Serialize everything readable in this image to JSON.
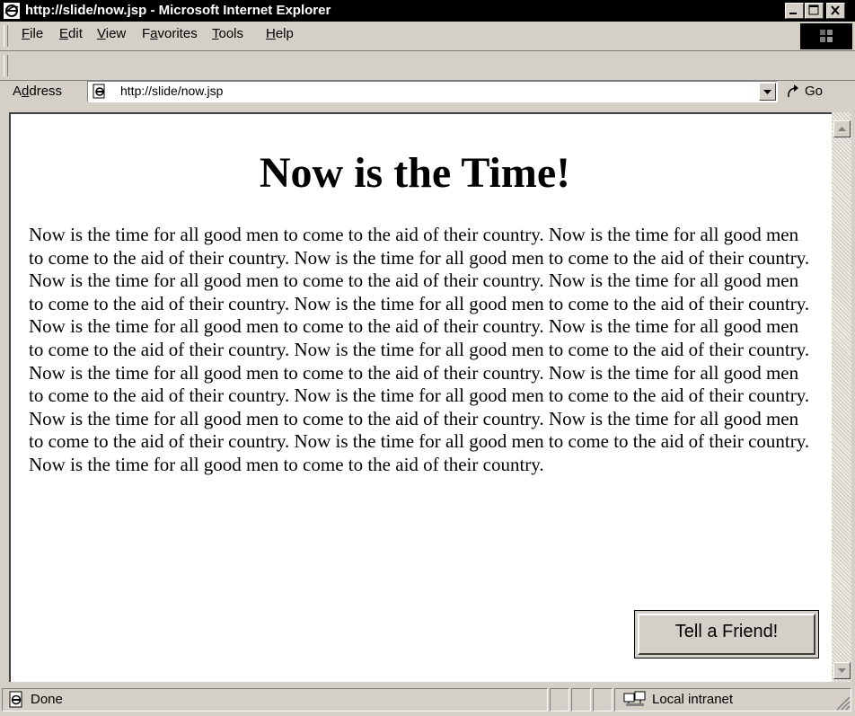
{
  "window": {
    "title": "http://slide/now.jsp - Microsoft Internet Explorer",
    "minimize_icon": "minimize-icon",
    "maximize_icon": "maximize-icon",
    "close_icon": "close-icon"
  },
  "menu": {
    "items": [
      {
        "label": "File",
        "accesskey": "F"
      },
      {
        "label": "Edit",
        "accesskey": "E"
      },
      {
        "label": "View",
        "accesskey": "V"
      },
      {
        "label": "Favorites",
        "accesskey": "a"
      },
      {
        "label": "Tools",
        "accesskey": "T"
      },
      {
        "label": "Help",
        "accesskey": "H"
      }
    ]
  },
  "address": {
    "label": "Address",
    "value": "http://slide/now.jsp",
    "go_label": "Go"
  },
  "page": {
    "heading": "Now is the Time!",
    "body": "Now is the time for all good men to come to the aid of their country. Now is the time for all good men to come to the aid of their country. Now is the time for all good men to come to the aid of their country. Now is the time for all good men to come to the aid of their country. Now is the time for all good men to come to the aid of their country. Now is the time for all good men to come to the aid of their country. Now is the time for all good men to come to the aid of their country. Now is the time for all good men to come to the aid of their country. Now is the time for all good men to come to the aid of their country. Now is the time for all good men to come to the aid of their country. Now is the time for all good men to come to the aid of their country. Now is the time for all good men to come to the aid of their country. Now is the time for all good men to come to the aid of their country. Now is the time for all good men to come to the aid of their country. Now is the time for all good men to come to the aid of their country. Now is the time for all good men to come to the aid of their country.",
    "button_label": "Tell a Friend!"
  },
  "status": {
    "text": "Done",
    "zone": "Local intranet"
  }
}
